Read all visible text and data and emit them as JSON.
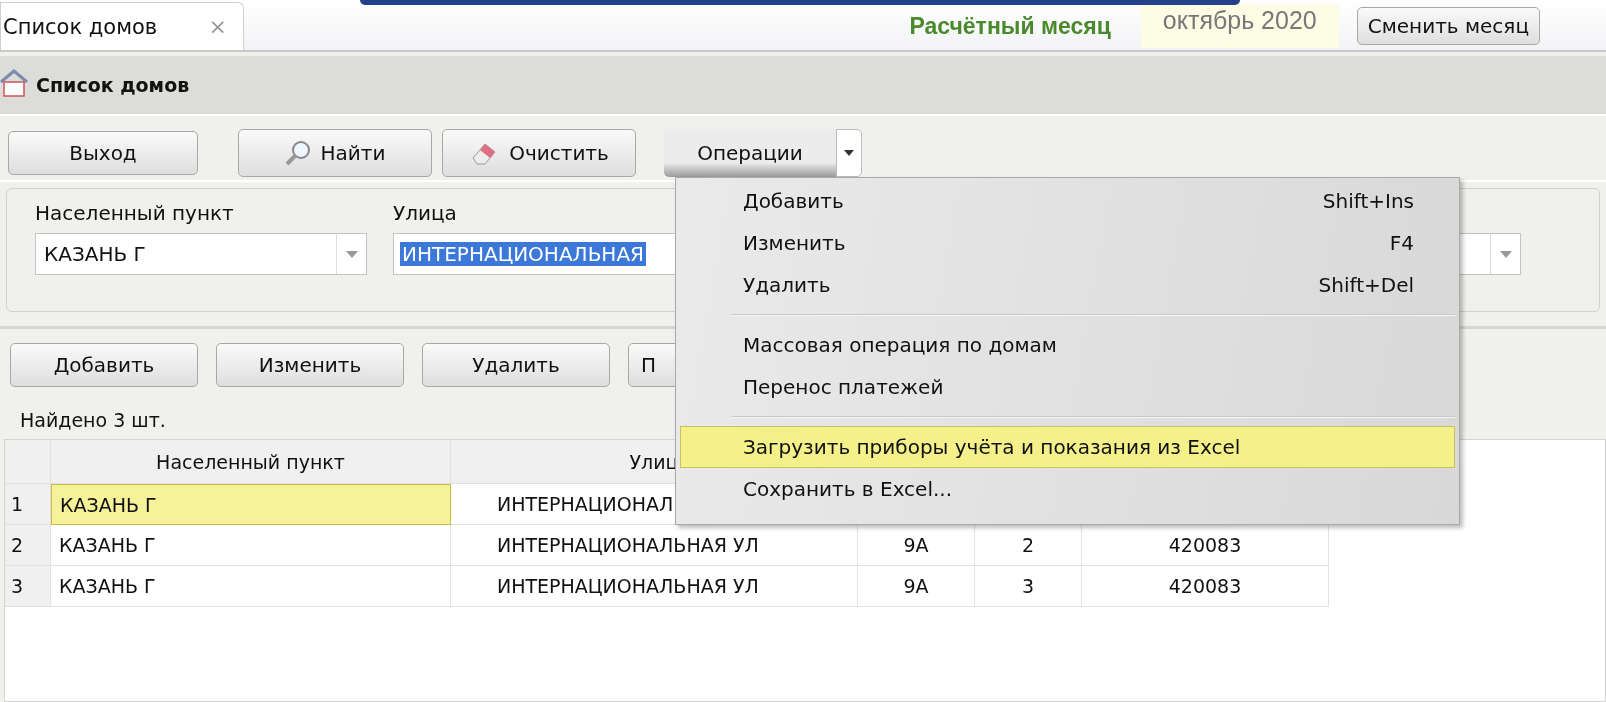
{
  "tab": {
    "label": "Список домов",
    "close": "×"
  },
  "period": {
    "label": "Расчётный месяц",
    "value": "октябрь 2020",
    "button": "Сменить месяц"
  },
  "title": "Список домов",
  "toolbar": [
    {
      "label": "Выход",
      "kind": "plain"
    },
    {
      "label": "Найти",
      "kind": "search"
    },
    {
      "label": "Очистить",
      "kind": "eraser"
    },
    {
      "label": "Операции",
      "kind": "split",
      "expanded": true
    }
  ],
  "filters": [
    {
      "label": "Населенный пункт",
      "value": "КАЗАНЬ Г",
      "highlighted": false
    },
    {
      "label": "Улица",
      "value": "ИНТЕРНАЦИОНАЛЬНАЯ",
      "highlighted": true
    }
  ],
  "actions": [
    "Добавить",
    "Изменить",
    "Удалить",
    "П"
  ],
  "found": "Найдено 3 шт.",
  "table": {
    "columns": [
      "Населенный пункт",
      "Улиц"
    ],
    "rows": [
      {
        "number": "1",
        "selected": true,
        "cells": [
          "КАЗАНЬ Г",
          "ИНТЕРНАЦИОНАЛ"
        ]
      },
      {
        "number": "2",
        "selected": false,
        "cells": [
          "КАЗАНЬ Г",
          "ИНТЕРНАЦИОНАЛЬНАЯ УЛ",
          "9А",
          "2",
          "420083"
        ]
      },
      {
        "number": "3",
        "selected": false,
        "cells": [
          "КАЗАНЬ Г",
          "ИНТЕРНАЦИОНАЛЬНАЯ УЛ",
          "9А",
          "3",
          "420083"
        ]
      }
    ]
  },
  "menu": {
    "items": [
      {
        "kind": "item",
        "label": "Добавить",
        "shortcut": "Shift+Ins",
        "selected": false
      },
      {
        "kind": "item",
        "label": "Изменить",
        "shortcut": "F4",
        "selected": false
      },
      {
        "kind": "item",
        "label": "Удалить",
        "shortcut": "Shift+Del",
        "selected": false
      },
      {
        "kind": "separator"
      },
      {
        "kind": "item",
        "label": "Массовая операция по домам",
        "selected": false
      },
      {
        "kind": "item",
        "label": "Перенос платежей",
        "selected": false
      },
      {
        "kind": "separator"
      },
      {
        "kind": "item",
        "label": "Загрузить приборы учёта и показания из Excel",
        "selected": true
      },
      {
        "kind": "item",
        "label": "Сохранить в Excel...",
        "selected": false
      }
    ]
  }
}
